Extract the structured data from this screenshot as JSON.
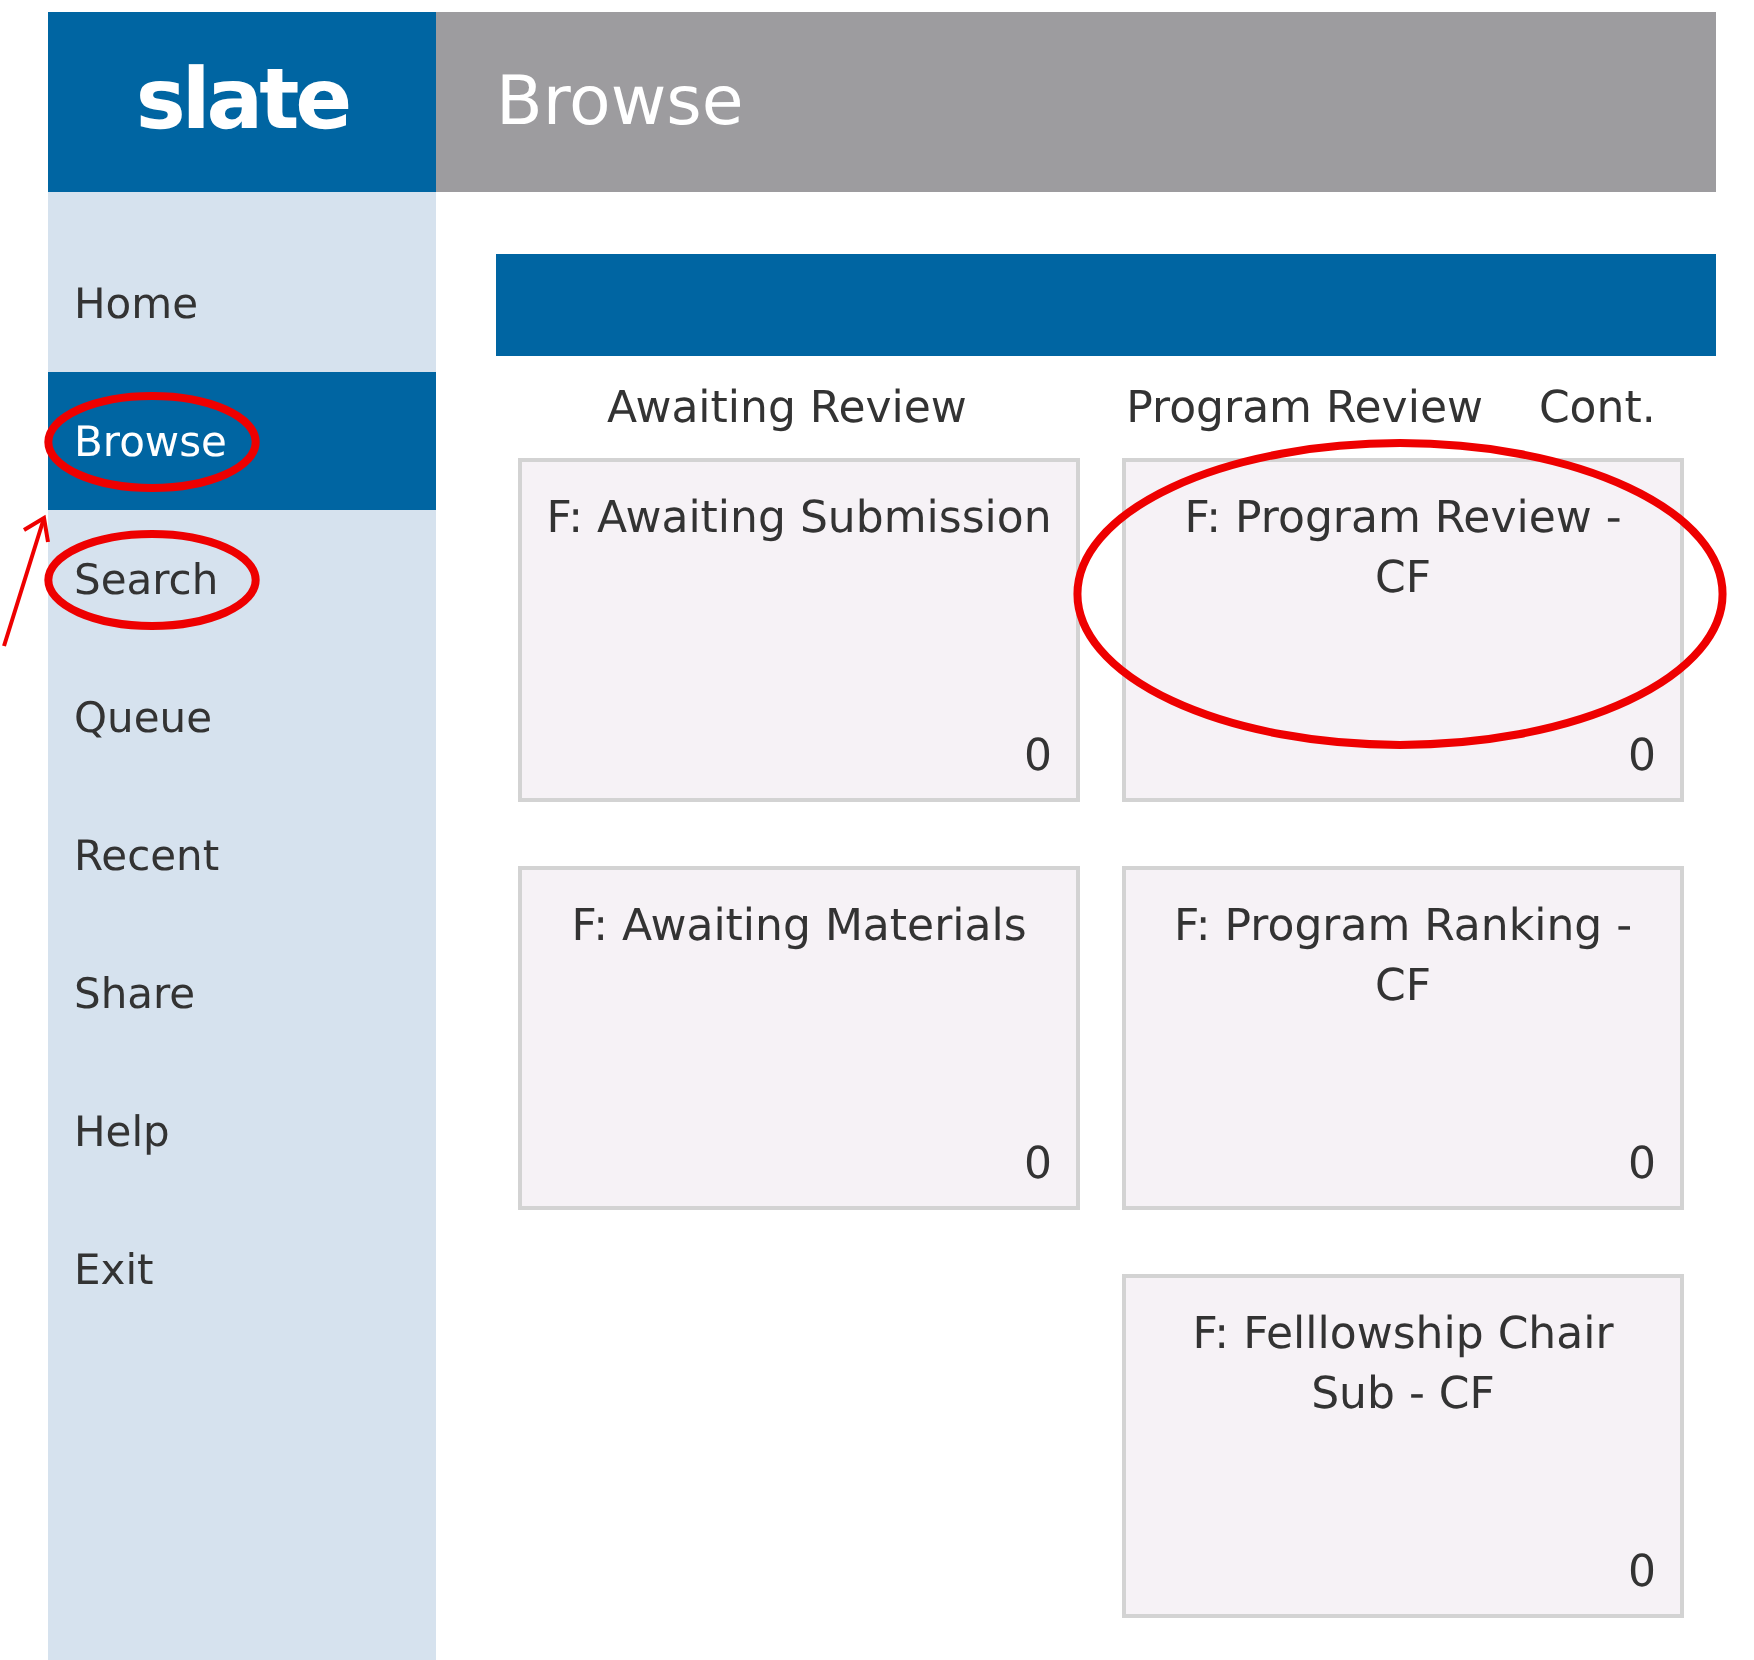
{
  "logo": "slate",
  "header": {
    "title": "Browse"
  },
  "sidebar": {
    "items": [
      {
        "label": "Home",
        "selected": false,
        "circled": false,
        "arrow": false
      },
      {
        "label": "Browse",
        "selected": true,
        "circled": true,
        "arrow": false
      },
      {
        "label": "Search",
        "selected": false,
        "circled": true,
        "arrow": true
      },
      {
        "label": "Queue",
        "selected": false,
        "circled": false,
        "arrow": false
      },
      {
        "label": "Recent",
        "selected": false,
        "circled": false,
        "arrow": false
      },
      {
        "label": "Share",
        "selected": false,
        "circled": false,
        "arrow": false
      },
      {
        "label": "Help",
        "selected": false,
        "circled": false,
        "arrow": false
      },
      {
        "label": "Exit",
        "selected": false,
        "circled": false,
        "arrow": false
      }
    ]
  },
  "columns": [
    {
      "heading": "Awaiting Review",
      "tiles": [
        {
          "title": "F: Awaiting Submission",
          "count": "0",
          "circled": false
        },
        {
          "title": "F: Awaiting Materials",
          "count": "0",
          "circled": false
        }
      ]
    },
    {
      "heading": "Program Review    Cont.",
      "tiles": [
        {
          "title": "F: Program Review - CF",
          "count": "0",
          "circled": true
        },
        {
          "title": "F: Program Ranking - CF",
          "count": "0",
          "circled": false
        },
        {
          "title": "F: Felllowship Chair Sub - CF",
          "count": "0",
          "circled": false
        }
      ]
    }
  ]
}
